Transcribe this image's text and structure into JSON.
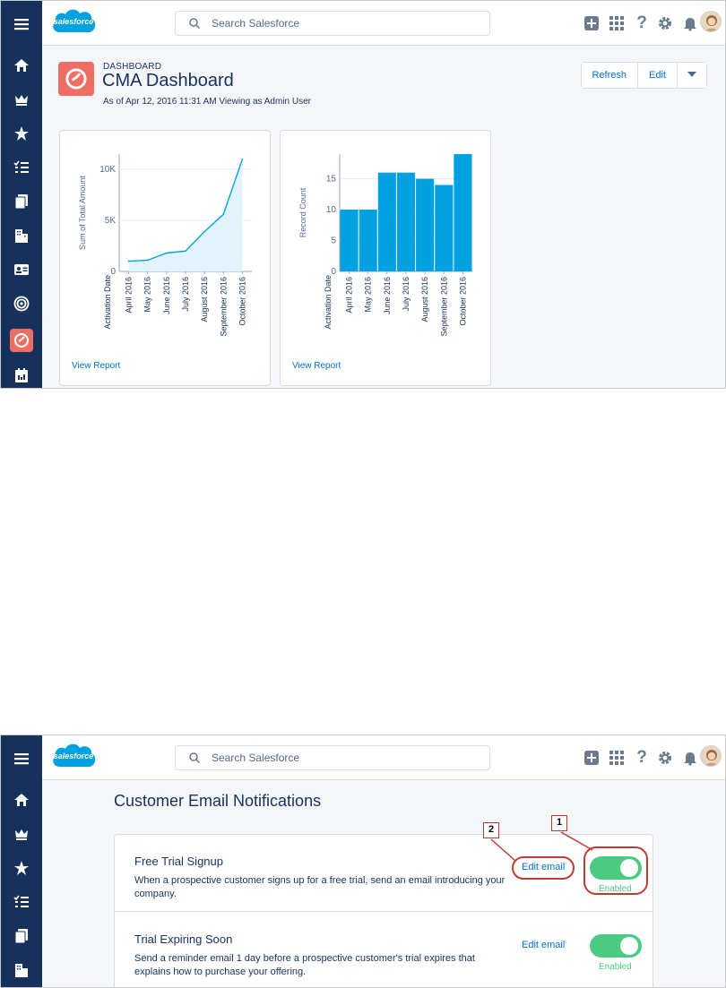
{
  "app": {
    "logo_text": "salesforce",
    "search_placeholder": "Search Salesforce",
    "icons": [
      "menu-icon",
      "home-icon",
      "crown-icon",
      "star-icon",
      "task-list-icon",
      "files-icon",
      "building-icon",
      "contact-card-icon",
      "target-icon",
      "dashboard-icon",
      "calendar-icon",
      "add-icon",
      "app-launcher-icon",
      "help-icon",
      "setup-gear-icon",
      "bell-icon"
    ]
  },
  "dashboard": {
    "kicker": "DASHBOARD",
    "title": "CMA Dashboard",
    "subtitle": "As of Apr 12, 2016 11:31 AM  Viewing as Admin User",
    "buttons": {
      "refresh": "Refresh",
      "edit": "Edit"
    },
    "view_report": "View Report",
    "accent": "#ef6e64"
  },
  "chart_data": [
    {
      "type": "area",
      "xlabel": "Activation Date",
      "ylabel": "Sum of Total Amount",
      "categories": [
        "April 2016",
        "May 2016",
        "June 2016",
        "July 2016",
        "August 2016",
        "September 2016",
        "October 2016"
      ],
      "values": [
        1000,
        1100,
        1800,
        2000,
        3900,
        5600,
        11000
      ],
      "yticks": [
        "0",
        "5K",
        "10K"
      ],
      "ylim": [
        0,
        11500
      ],
      "color": "#00a1e0"
    },
    {
      "type": "bar",
      "xlabel": "Activation Date",
      "ylabel": "Record Count",
      "categories": [
        "April 2016",
        "May 2016",
        "June 2016",
        "July 2016",
        "August 2016",
        "September 2016",
        "October 2016"
      ],
      "values": [
        10,
        10,
        16,
        16,
        15,
        14,
        19
      ],
      "yticks": [
        "0",
        "5",
        "10",
        "15"
      ],
      "ylim": [
        0,
        19
      ],
      "color": "#00a1e0"
    }
  ],
  "notifications": {
    "title": "Customer Email Notifications",
    "items": [
      {
        "title": "Free Trial Signup",
        "description": "When a prospective customer signs up for a free trial, send an email introducing your company.",
        "edit_label": "Edit email",
        "status": "Enabled",
        "enabled": true
      },
      {
        "title": "Trial Expiring Soon",
        "description": "Send a reminder email 1 day before a prospective customer's trial expires that explains how to purchase your offering.",
        "edit_label": "Edit email",
        "status": "Enabled",
        "enabled": true
      }
    ],
    "callouts": [
      "1",
      "2"
    ],
    "highlight_color": "#c23934"
  }
}
